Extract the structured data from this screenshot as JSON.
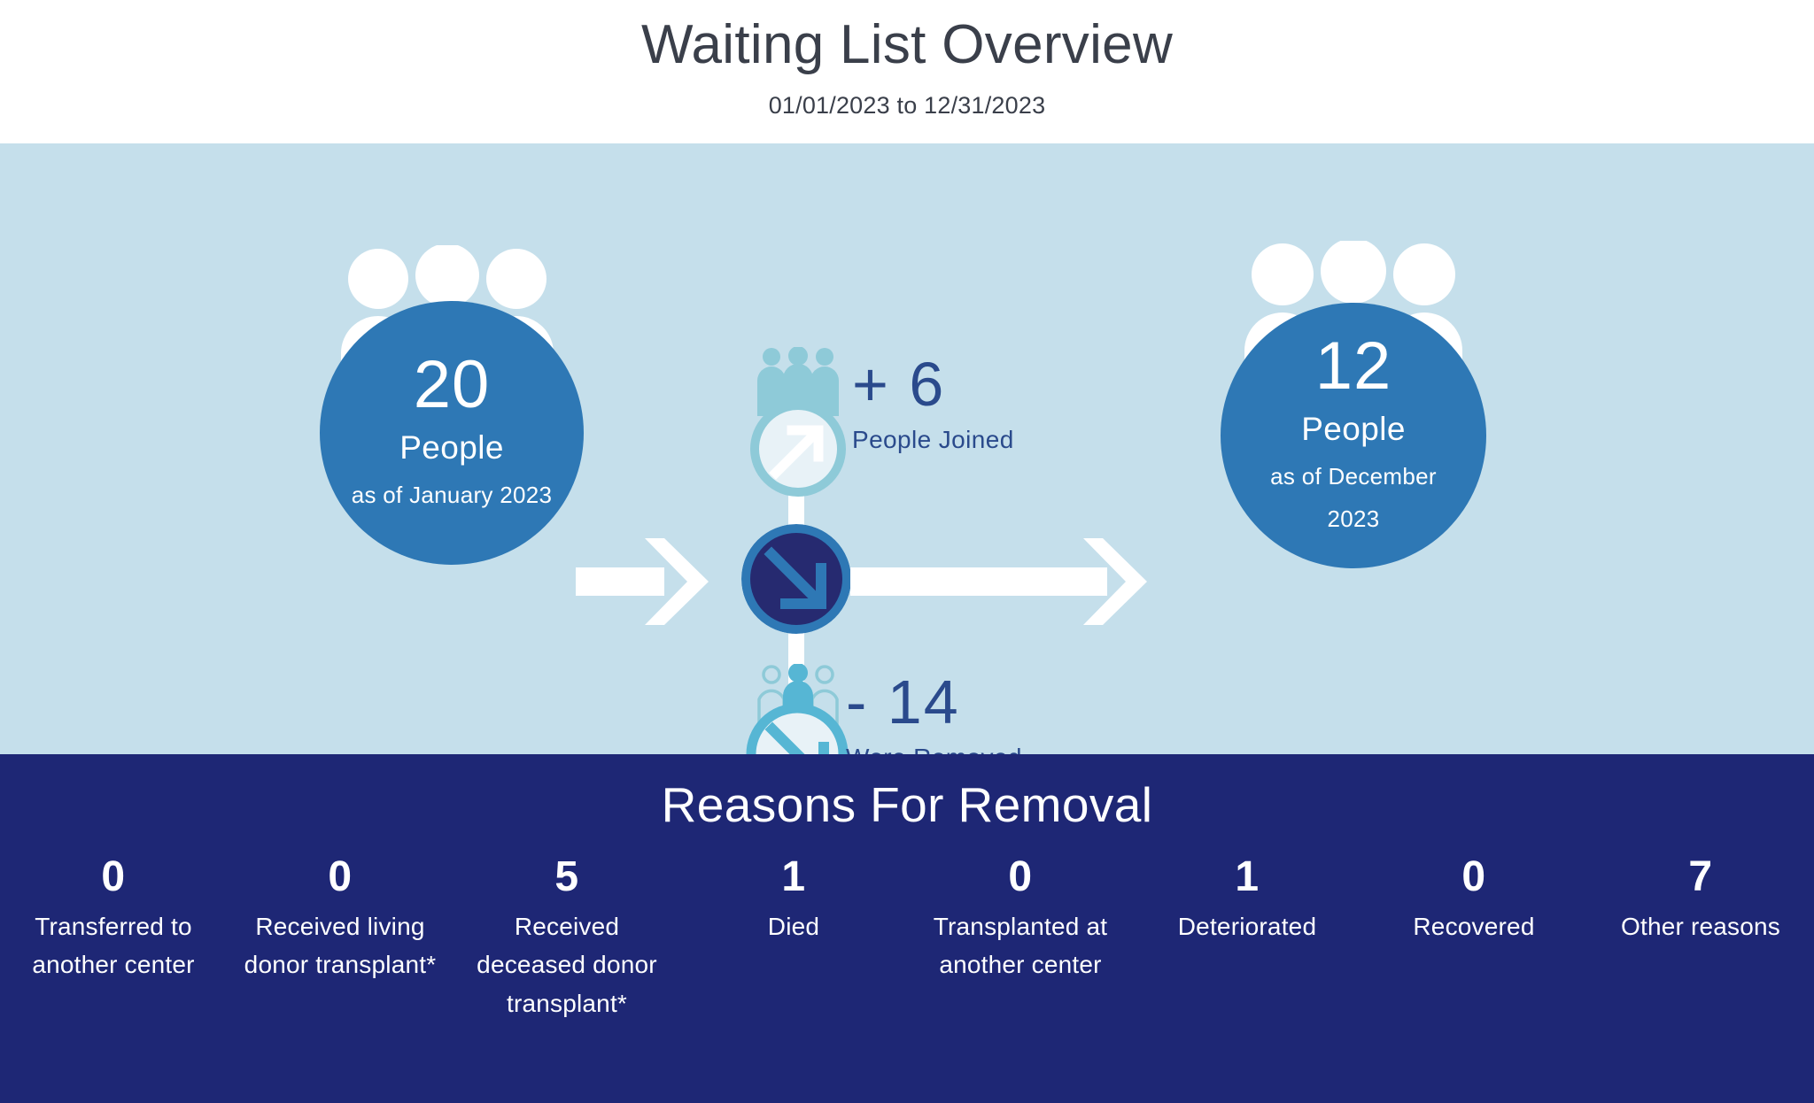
{
  "header": {
    "title": "Waiting List Overview",
    "date_range": "01/01/2023 to 12/31/2023"
  },
  "flow": {
    "start": {
      "number": "20",
      "label": "People",
      "sublabel": "as of January 2023"
    },
    "end": {
      "number": "12",
      "label": "People",
      "sublabel_line1": "as of December",
      "sublabel_line2": "2023"
    },
    "joined": {
      "number": "+ 6",
      "label": "People Joined"
    },
    "removed": {
      "number": "- 14",
      "label": "Were Removed"
    }
  },
  "reasons": {
    "title": "Reasons For Removal",
    "items": [
      {
        "count": "0",
        "label": "Transferred to another center"
      },
      {
        "count": "0",
        "label": "Received living donor transplant*"
      },
      {
        "count": "5",
        "label": "Received deceased donor transplant*"
      },
      {
        "count": "1",
        "label": "Died"
      },
      {
        "count": "0",
        "label": "Transplanted at another center"
      },
      {
        "count": "1",
        "label": "Deteriorated"
      },
      {
        "count": "0",
        "label": "Recovered"
      },
      {
        "count": "7",
        "label": "Other reasons"
      }
    ]
  },
  "colors": {
    "page_background": "#ffffff",
    "flow_background": "#c5dfeb",
    "reasons_background": "#1e2775",
    "circle_blue": "#2e78b5",
    "center_navy": "#262a70",
    "accent_light": "#8ecad8",
    "accent_pale": "#a8d4e0",
    "text_dark": "#3a3f4a",
    "text_accent": "#2a4a8c",
    "white": "#ffffff"
  },
  "chart_data": {
    "type": "diagram",
    "title": "Waiting List Overview",
    "subtitle": "01/01/2023 to 12/31/2023",
    "flow": {
      "start_value": 20,
      "start_label": "People as of January 2023",
      "joined": 6,
      "removed": 14,
      "end_value": 12,
      "end_label": "People as of December 2023"
    },
    "removal_reasons": {
      "categories": [
        "Transferred to another center",
        "Received living donor transplant*",
        "Received deceased donor transplant*",
        "Died",
        "Transplanted at another center",
        "Deteriorated",
        "Recovered",
        "Other reasons"
      ],
      "values": [
        0,
        0,
        5,
        1,
        0,
        1,
        0,
        7
      ]
    }
  }
}
